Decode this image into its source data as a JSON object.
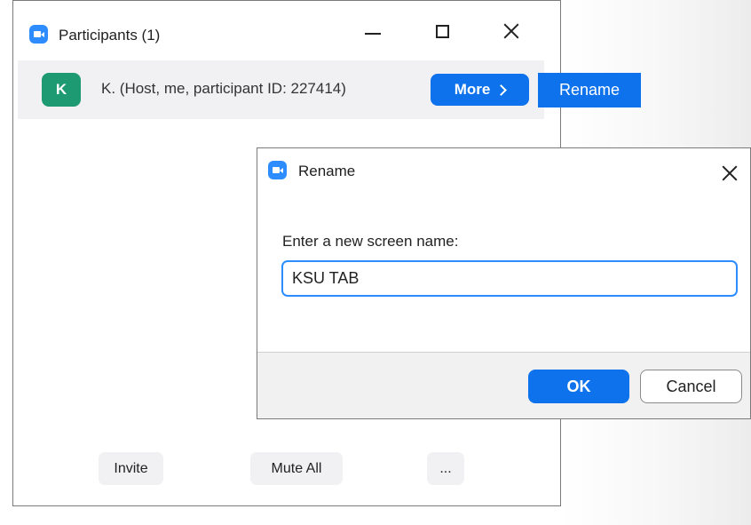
{
  "participants_window": {
    "title": "Participants (1)",
    "participant": {
      "avatar_initial": "K",
      "name": "K. (Host, me, participant ID: 227414)",
      "more_label": "More"
    },
    "footer": {
      "invite_label": "Invite",
      "mute_all_label": "Mute All",
      "more_options_label": "..."
    }
  },
  "more_menu": {
    "rename_label": "Rename"
  },
  "rename_dialog": {
    "title": "Rename",
    "prompt": "Enter a new screen name:",
    "input_value": "KSU TAB",
    "ok_label": "OK",
    "cancel_label": "Cancel"
  },
  "colors": {
    "accent": "#0e72ed",
    "avatar": "#1e9a72",
    "app_icon": "#2d8cff"
  }
}
